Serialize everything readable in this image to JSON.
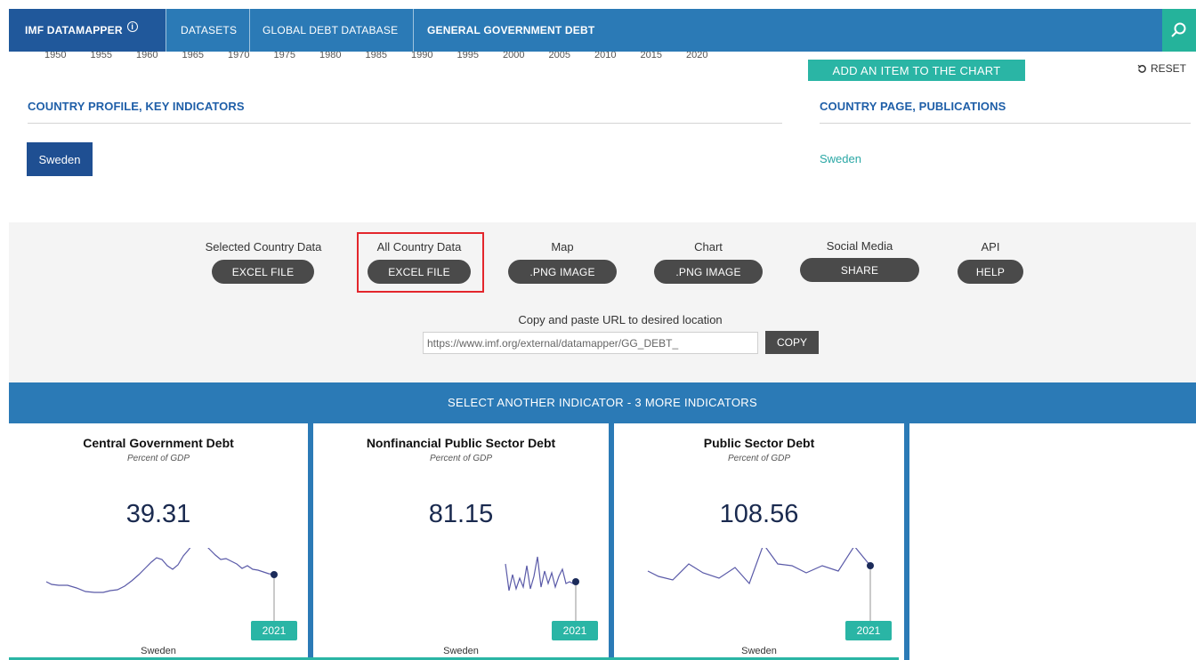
{
  "nav": {
    "brand": "IMF DATAMAPPER",
    "brand_info_glyph": "i",
    "datasets": "DATASETS",
    "global_debt": "GLOBAL DEBT DATABASE",
    "current": "GENERAL GOVERNMENT DEBT",
    "search_icon": "search-icon"
  },
  "timeline": {
    "years": [
      "1950",
      "1955",
      "1960",
      "1965",
      "1970",
      "1975",
      "1980",
      "1985",
      "1990",
      "1995",
      "2000",
      "2005",
      "2010",
      "2015",
      "2020"
    ]
  },
  "controls": {
    "add_item": "ADD AN ITEM TO THE CHART",
    "reset": "RESET"
  },
  "profile": {
    "title": "COUNTRY PROFILE, KEY INDICATORS",
    "country_button": "Sweden"
  },
  "publications": {
    "title": "COUNTRY PAGE, PUBLICATIONS",
    "country_link": "Sweden"
  },
  "export": {
    "items": [
      {
        "label": "Selected Country Data",
        "button": "EXCEL FILE"
      },
      {
        "label": "All Country Data",
        "button": "EXCEL FILE"
      },
      {
        "label": "Map",
        "button": ".PNG IMAGE"
      },
      {
        "label": "Chart",
        "button": ".PNG IMAGE"
      },
      {
        "label": "Social Media",
        "button": "SHARE"
      },
      {
        "label": "API",
        "button": "HELP"
      }
    ],
    "url_label": "Copy and paste URL to desired location",
    "url_value": "https://www.imf.org/external/datamapper/GG_DEBT_",
    "copy": "COPY"
  },
  "indicators": {
    "banner": "SELECT ANOTHER INDICATOR -  3  MORE INDICATORS",
    "cards": [
      {
        "title": "Central Government Debt",
        "subtitle": "Percent of GDP",
        "value": "39.31",
        "year": "2021",
        "country": "Sweden"
      },
      {
        "title": "Nonfinancial Public Sector Debt",
        "subtitle": "Percent of GDP",
        "value": "81.15",
        "year": "2021",
        "country": "Sweden"
      },
      {
        "title": "Public Sector Debt",
        "subtitle": "Percent of GDP",
        "value": "108.56",
        "year": "2021",
        "country": "Sweden"
      }
    ]
  },
  "colors": {
    "nav_blue": "#2b7ab6",
    "brand_blue": "#20589b",
    "teal": "#2ab5a5",
    "title_blue": "#1f5fa8",
    "highlight_red": "#e3262c",
    "spark_line": "#5a5aa8"
  }
}
